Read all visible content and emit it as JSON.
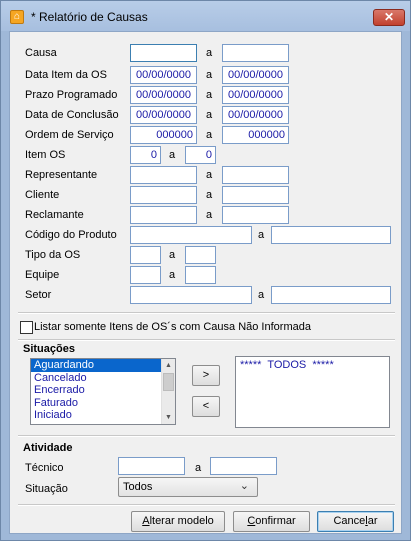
{
  "window": {
    "title": "* Relatório de Causas",
    "close_glyph": "✕",
    "app_icon": "orange-app-icon"
  },
  "separator_a": "a",
  "filters": {
    "causa": {
      "label": "Causa",
      "from": "",
      "to": ""
    },
    "data_item_os": {
      "label": "Data Item da OS",
      "from": "00/00/0000",
      "to": "00/00/0000"
    },
    "prazo_programado": {
      "label": "Prazo Programado",
      "from": "00/00/0000",
      "to": "00/00/0000"
    },
    "data_conclusao": {
      "label": "Data de Conclusão",
      "from": "00/00/0000",
      "to": "00/00/0000"
    },
    "ordem_servico": {
      "label": "Ordem de Serviço",
      "from": "000000",
      "to": "000000"
    },
    "item_os": {
      "label": "Item OS",
      "from": "0",
      "to": "0"
    },
    "representante": {
      "label": "Representante",
      "from": "",
      "to": ""
    },
    "cliente": {
      "label": "Cliente",
      "from": "",
      "to": ""
    },
    "reclamante": {
      "label": "Reclamante",
      "from": "",
      "to": ""
    },
    "codigo_produto": {
      "label": "Código do Produto",
      "from": "",
      "to": ""
    },
    "tipo_os": {
      "label": "Tipo da OS",
      "from": "",
      "to": ""
    },
    "equipe": {
      "label": "Equipe",
      "from": "",
      "to": ""
    },
    "setor": {
      "label": "Setor",
      "from": "",
      "to": ""
    }
  },
  "checkbox_sem_causa": {
    "label": "Listar somente Itens de OS´s com Causa Não Informada",
    "checked": false
  },
  "situacoes": {
    "title": "Situações",
    "available": [
      "Aguardando",
      "Cancelado",
      "Encerrado",
      "Faturado",
      "Iniciado"
    ],
    "selected_index": 0,
    "add_button": ">",
    "remove_button": "<",
    "chosen": [
      "*****  TODOS  *****"
    ]
  },
  "atividade": {
    "title": "Atividade",
    "tecnico": {
      "label": "Técnico",
      "from": "",
      "to": ""
    },
    "situacao": {
      "label": "Situação",
      "value": "Todos",
      "chevron": "chevron-down-icon"
    }
  },
  "buttons": {
    "alterar_modelo": {
      "prefix": "",
      "accel": "A",
      "rest": "lterar modelo"
    },
    "confirmar": {
      "prefix": "",
      "accel": "C",
      "rest": "onfirmar"
    },
    "cancelar": {
      "prefix": "Cance",
      "accel": "l",
      "rest": "ar"
    }
  }
}
